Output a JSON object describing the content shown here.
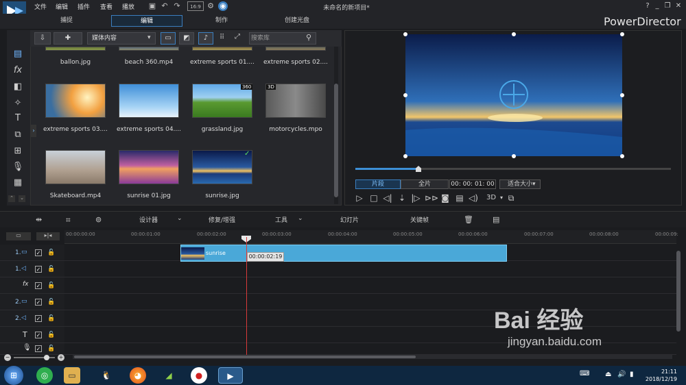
{
  "app": {
    "menu": [
      "文件",
      "编辑",
      "插件",
      "查看",
      "播放"
    ],
    "project_title": "未命名的新项目*",
    "brand": "PowerDirector",
    "window_buttons": [
      "?",
      "_",
      "❐",
      "✕"
    ]
  },
  "tabs": [
    "捕捉",
    "编辑",
    "制作",
    "创建光盘"
  ],
  "library": {
    "media_select": "媒体内容",
    "search_placeholder": "搜索库",
    "items": [
      {
        "caption": "ballon.jpg"
      },
      {
        "caption": "beach 360.mp4"
      },
      {
        "caption": "extreme sports 01...."
      },
      {
        "caption": "extreme sports 02...."
      },
      {
        "caption": "extreme sports 03...."
      },
      {
        "caption": "extreme sports 04...."
      },
      {
        "caption": "grassland.jpg",
        "badge": "360"
      },
      {
        "caption": "motorcycles.mpo",
        "badge": "3D"
      },
      {
        "caption": "Skateboard.mp4"
      },
      {
        "caption": "sunrise 01.jpg"
      },
      {
        "caption": "sunrise.jpg",
        "badge": "✓"
      }
    ]
  },
  "preview": {
    "clip_btn": "片段",
    "full_btn": "全片",
    "timecode": "00: 00: 01: 00",
    "fit": "适合大小",
    "mode_3d": "3D",
    "progress": 0.2
  },
  "toolbar": {
    "designer": "设计器",
    "fix": "修复/增强",
    "tools": "工具",
    "slideshow": "幻灯片",
    "keyframe": "关键帧"
  },
  "ruler": [
    "00:00:00:00",
    "00:00:01:00",
    "00:00:02:00",
    "00:00:03:00",
    "00:00:04:00",
    "00:00:05:00",
    "00:00:06:00",
    "00:00:07:00",
    "00:00:08:00",
    "00:00:09:"
  ],
  "tracks": [
    {
      "label": "1.",
      "icon": "video"
    },
    {
      "label": "1.",
      "icon": "audio"
    },
    {
      "label": "fx",
      "icon": "fx"
    },
    {
      "label": "2.",
      "icon": "video"
    },
    {
      "label": "2.",
      "icon": "audio"
    },
    {
      "label": "T",
      "icon": "title"
    },
    {
      "label": "",
      "icon": "mic"
    }
  ],
  "timeline": {
    "clip_name": "sunrise",
    "tooltip": "00:00:02:19"
  },
  "taskbar": {
    "time": "21:11",
    "date": "2018/12/19"
  },
  "watermark": {
    "main": "Bai 经验",
    "url": "jingyan.baidu.com"
  },
  "colors": {
    "accent": "#3b7fc0",
    "clip": "#4aa8d8",
    "playhead": "#d93a3a"
  }
}
